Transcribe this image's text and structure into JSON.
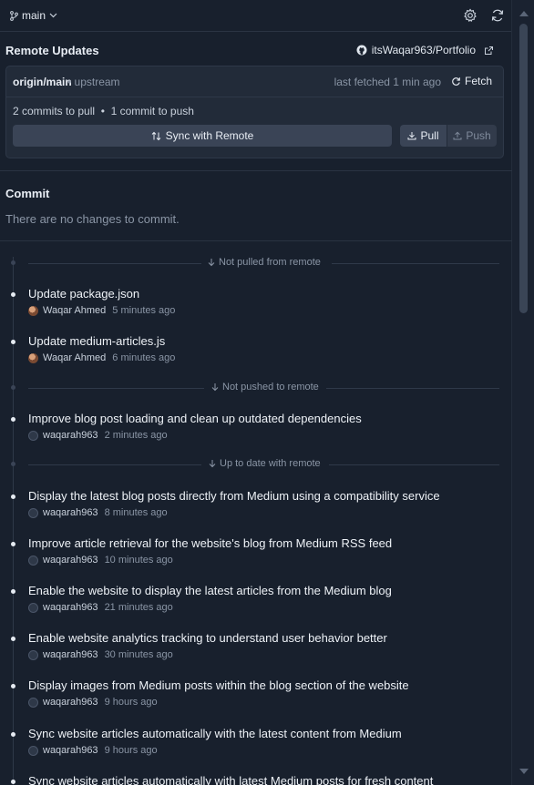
{
  "branch": {
    "name": "main"
  },
  "remote": {
    "title": "Remote Updates",
    "repo": "itsWaqar963/Portfolio",
    "origin": "origin/main",
    "upstream": "• upstream",
    "last_fetched": "last fetched 1 min ago",
    "fetch_label": "Fetch",
    "counts": "2 commits to pull  •  1 commit to push",
    "sync_label": "Sync with Remote",
    "pull_label": "Pull",
    "push_label": "Push"
  },
  "commit_section": {
    "title": "Commit",
    "empty_message": "There are no changes to commit."
  },
  "separators": {
    "not_pulled": "Not pulled from remote",
    "not_pushed": "Not pushed to remote",
    "up_to_date": "Up to date with remote"
  },
  "commits": [
    {
      "message": "Update package.json",
      "author": "Waqar Ahmed",
      "time": "5 minutes ago"
    },
    {
      "message": "Update medium-articles.js",
      "author": "Waqar Ahmed",
      "time": "6 minutes ago"
    },
    {
      "message": "Improve blog post loading and clean up outdated dependencies",
      "author": "waqarah963",
      "time": "2 minutes ago"
    },
    {
      "message": "Display the latest blog posts directly from Medium using a compatibility service",
      "author": "waqarah963",
      "time": "8 minutes ago"
    },
    {
      "message": "Improve article retrieval for the website's blog from Medium RSS feed",
      "author": "waqarah963",
      "time": "10 minutes ago"
    },
    {
      "message": "Enable the website to display the latest articles from the Medium blog",
      "author": "waqarah963",
      "time": "21 minutes ago"
    },
    {
      "message": "Enable website analytics tracking to understand user behavior better",
      "author": "waqarah963",
      "time": "30 minutes ago"
    },
    {
      "message": "Display images from Medium posts within the blog section of the website",
      "author": "waqarah963",
      "time": "9 hours ago"
    },
    {
      "message": "Sync website articles automatically with the latest content from Medium",
      "author": "waqarah963",
      "time": "9 hours ago"
    },
    {
      "message": "Sync website articles automatically with latest Medium posts for fresh content",
      "author": "waqarah963",
      "time": ""
    }
  ]
}
